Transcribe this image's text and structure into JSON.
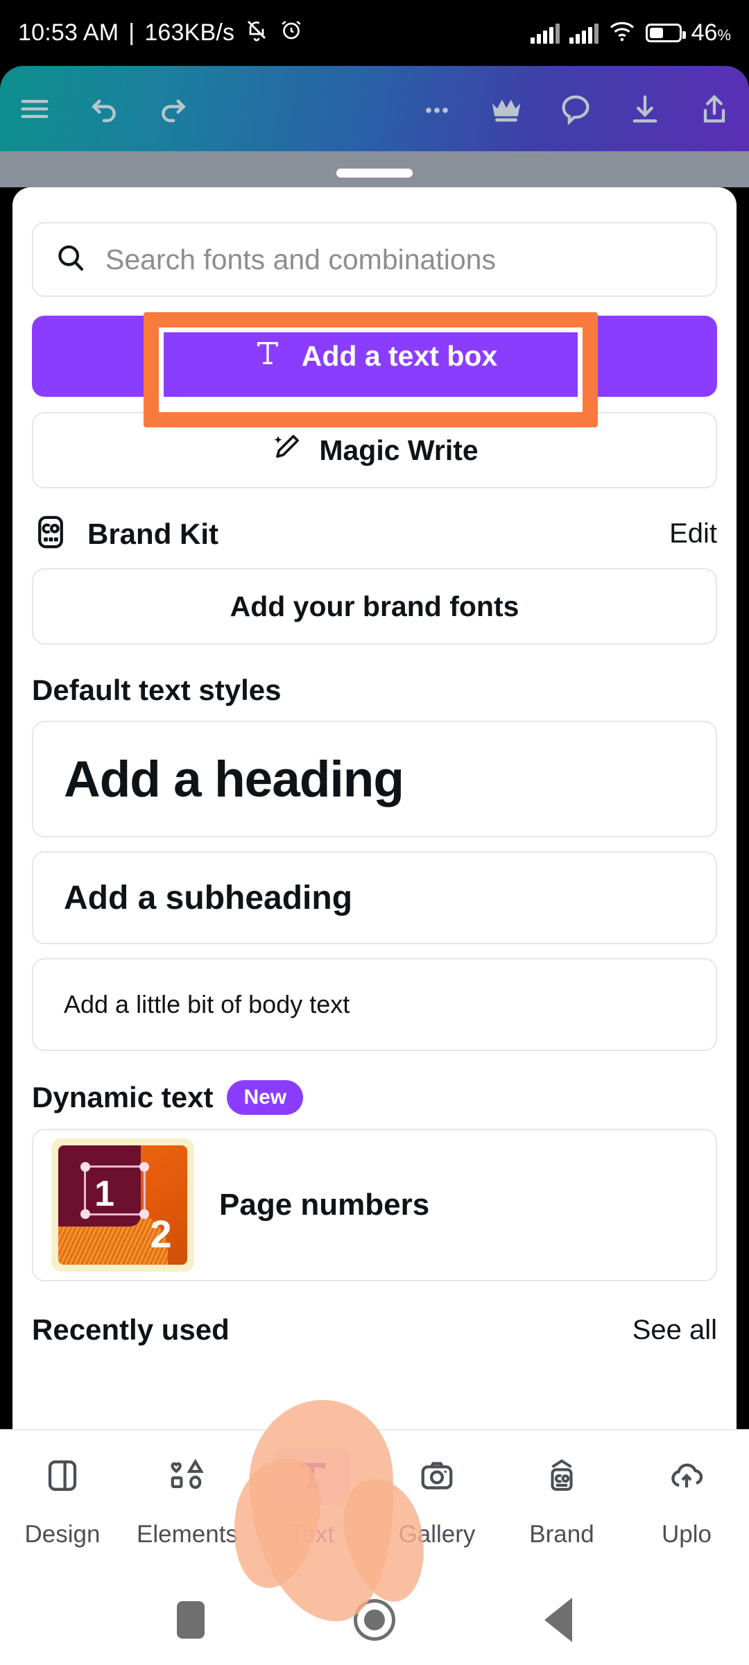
{
  "status_bar": {
    "time": "10:53 AM",
    "separator": "|",
    "network_speed": "163KB/s",
    "mute_icon": "bell-muted-icon",
    "alarm_icon": "alarm-clock-icon",
    "signal_icon": "cellular-signal-icon",
    "signal_icon_2": "cellular-signal-icon-2",
    "wifi_icon": "wifi-icon",
    "battery_icon": "battery-icon",
    "battery_percent": "46",
    "battery_unit": "%"
  },
  "toolbar": {
    "menu_icon": "hamburger-menu-icon",
    "undo_icon": "undo-icon",
    "redo_icon": "redo-icon",
    "more_icon": "more-options-icon",
    "crown_icon": "crown-icon",
    "comment_icon": "comment-bubble-icon",
    "download_icon": "download-icon",
    "share_icon": "share-icon",
    "gradient_start": "#0d8f8d",
    "gradient_end": "#5a2fb6"
  },
  "sheet": {
    "drag_handle": "sheet-drag-handle",
    "search": {
      "icon": "search-icon",
      "placeholder": "Search fonts and combinations",
      "value": ""
    },
    "add_text_box": {
      "label": "Add a text box",
      "icon": "text-t-icon",
      "color": "#8b3dff"
    },
    "magic_write": {
      "label": "Magic Write",
      "icon": "magic-pencil-icon"
    },
    "brand_kit": {
      "title": "Brand Kit",
      "icon": "brand-kit-icon",
      "edit_label": "Edit",
      "add_fonts_label": "Add your brand fonts"
    },
    "default_text_styles": {
      "title": "Default text styles",
      "items": [
        {
          "label": "Add a heading"
        },
        {
          "label": "Add a subheading"
        },
        {
          "label": "Add a little bit of body text"
        }
      ]
    },
    "dynamic_text": {
      "title": "Dynamic text",
      "badge": "New",
      "badge_color": "#8b3dff",
      "items": [
        {
          "label": "Page numbers",
          "thumb_number_1": "1",
          "thumb_number_2": "2"
        }
      ]
    },
    "recently_used": {
      "title": "Recently used",
      "see_all_label": "See all"
    }
  },
  "bottom_nav": {
    "items": [
      {
        "label": "Design",
        "icon": "layout-design-icon",
        "active": false
      },
      {
        "label": "Elements",
        "icon": "shapes-elements-icon",
        "active": false
      },
      {
        "label": "Text",
        "icon": "text-t-icon",
        "active": true
      },
      {
        "label": "Gallery",
        "icon": "camera-gallery-icon",
        "active": false
      },
      {
        "label": "Brand",
        "icon": "brand-kit-icon",
        "active": false
      },
      {
        "label": "Uplo",
        "icon": "cloud-upload-icon",
        "active": false
      }
    ],
    "active_color": "#8b3dff"
  },
  "system_nav": {
    "recents_icon": "recents-square-icon",
    "home_icon": "home-circle-icon",
    "back_icon": "back-triangle-icon"
  },
  "annotations": {
    "highlight_box": {
      "target": "add-a-text-box-button",
      "color": "#f97a3d"
    },
    "touch_blob": {
      "target": "bottom-nav-text-tab",
      "color": "#f9b18c"
    }
  }
}
